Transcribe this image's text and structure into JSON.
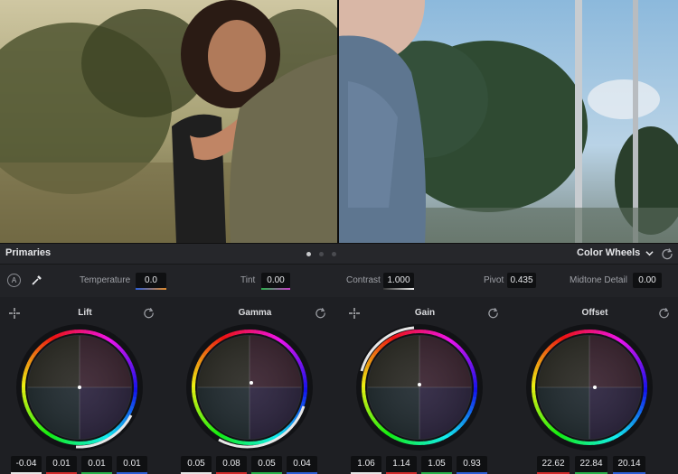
{
  "panel": {
    "title": "Primaries",
    "mode": "Color Wheels",
    "page_count": 3,
    "active_page": 1
  },
  "adjustments": {
    "temperature": {
      "label": "Temperature",
      "value": "0.0"
    },
    "tint": {
      "label": "Tint",
      "value": "0.00"
    },
    "contrast": {
      "label": "Contrast",
      "value": "1.000"
    },
    "pivot": {
      "label": "Pivot",
      "value": "0.435"
    },
    "midtone_detail": {
      "label": "Midtone Detail",
      "value": "0.00"
    },
    "auto_badge": "A"
  },
  "wheels": [
    {
      "name": "Lift",
      "values": [
        "-0.04",
        "0.01",
        "0.01",
        "0.01"
      ]
    },
    {
      "name": "Gamma",
      "values": [
        "0.05",
        "0.08",
        "0.05",
        "0.04"
      ]
    },
    {
      "name": "Gain",
      "values": [
        "1.06",
        "1.14",
        "1.05",
        "0.93"
      ]
    },
    {
      "name": "Offset",
      "values": [
        "22.62",
        "22.84",
        "20.14"
      ]
    }
  ],
  "colors": {
    "channel_master": "#e6e6e6",
    "channel_red": "#d32a2a",
    "channel_green": "#2ab14a",
    "channel_blue": "#2c5fd6",
    "temperature_accent": "#e08a2c",
    "tint_accent": "#c83cc8"
  },
  "icons": {
    "auto_balance": "auto-balance-icon",
    "picker": "eyedropper-icon",
    "reset": "reset-icon",
    "chevron": "chevron-down-icon"
  }
}
